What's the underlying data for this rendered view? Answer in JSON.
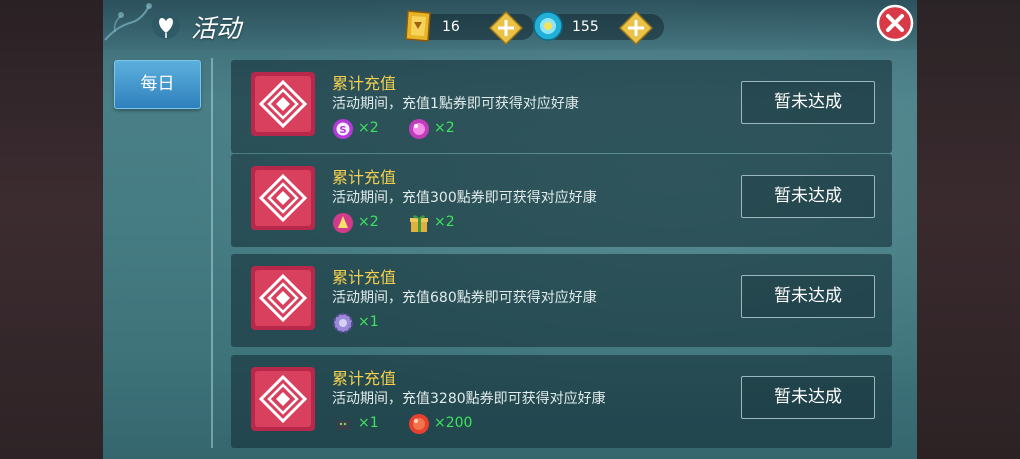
{
  "header": {
    "title": "活动",
    "currencies": [
      {
        "name": "coupon",
        "icon": "gold-coupon-icon",
        "value": "16"
      },
      {
        "name": "gem",
        "icon": "blue-gem-icon",
        "value": "155"
      }
    ]
  },
  "sidebar": {
    "tabs": [
      {
        "label": "每日"
      }
    ]
  },
  "activities": [
    {
      "title": "累计充值",
      "description": "活动期间，充值1點券即可获得对应好康",
      "status": "暂未达成",
      "rewards": [
        {
          "icon": "purple-s-badge-icon",
          "quantity": "×2"
        },
        {
          "icon": "pink-orb-icon",
          "quantity": "×2"
        }
      ]
    },
    {
      "title": "累计充值",
      "description": "活动期间，充值300點券即可获得对应好康",
      "status": "暂未达成",
      "rewards": [
        {
          "icon": "magenta-orb-icon",
          "quantity": "×2"
        },
        {
          "icon": "gift-box-icon",
          "quantity": "×2"
        }
      ]
    },
    {
      "title": "累计充值",
      "description": "活动期间，充值680點券即可获得对应好康",
      "status": "暂未达成",
      "rewards": [
        {
          "icon": "lavender-gear-icon",
          "quantity": "×1"
        }
      ]
    },
    {
      "title": "累计充值",
      "description": "活动期间，充值3280點券即可获得对应好康",
      "status": "暂未达成",
      "rewards": [
        {
          "icon": "dark-creature-icon",
          "quantity": "×1"
        },
        {
          "icon": "red-orb-icon",
          "quantity": "×200"
        }
      ]
    }
  ],
  "colors": {
    "title_yellow": "#f3cf4e",
    "reward_green": "#3ee35e",
    "tab_blue": "#2f81bd",
    "close_red": "#d93a48"
  }
}
